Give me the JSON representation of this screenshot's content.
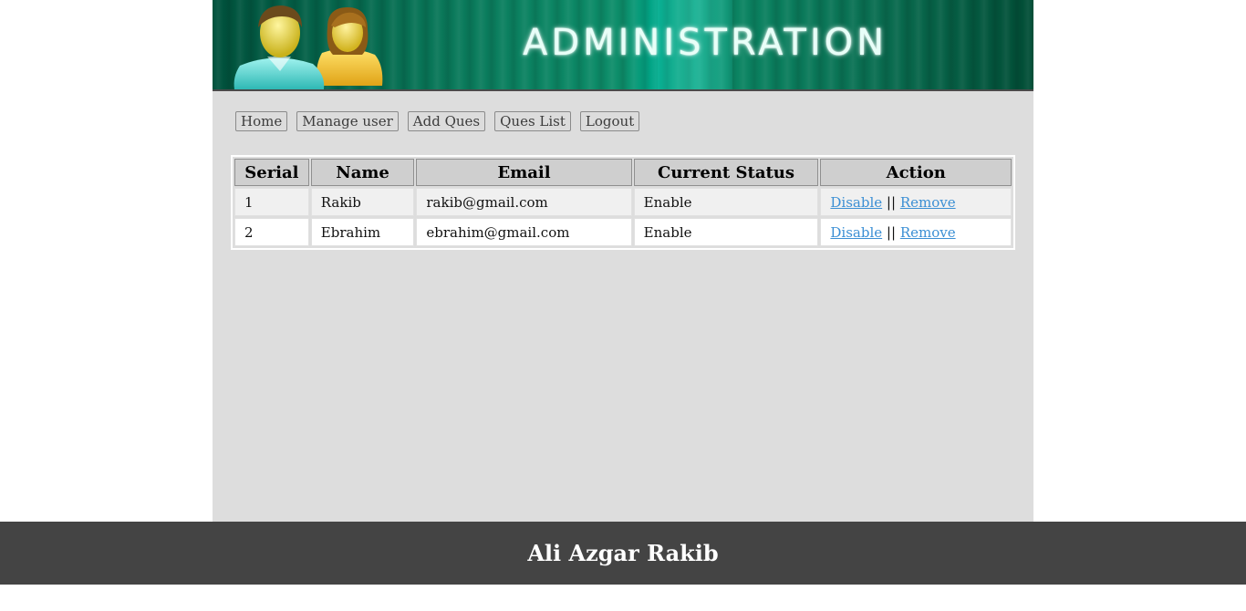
{
  "banner": {
    "title": "ADMINISTRATION",
    "icon": "users-icon"
  },
  "nav": {
    "home": "Home",
    "manage_user": "Manage user",
    "add_ques": "Add Ques",
    "ques_list": "Ques List",
    "logout": "Logout"
  },
  "table": {
    "headers": [
      "Serial",
      "Name",
      "Email",
      "Current Status",
      "Action"
    ],
    "rows": [
      {
        "serial": "1",
        "name": "Rakib",
        "email": "rakib@gmail.com",
        "status": "Enable",
        "action_disable": "Disable",
        "separator": "||",
        "action_remove": "Remove"
      },
      {
        "serial": "2",
        "name": "Ebrahim",
        "email": "ebrahim@gmail.com",
        "status": "Enable",
        "action_disable": "Disable",
        "separator": "||",
        "action_remove": "Remove"
      }
    ]
  },
  "footer": {
    "text": "Ali Azgar Rakib"
  },
  "colors": {
    "banner_green": "#0a7a5b",
    "page_bg": "#dddddd",
    "footer_bg": "#444444",
    "link": "#3b8fd4"
  }
}
